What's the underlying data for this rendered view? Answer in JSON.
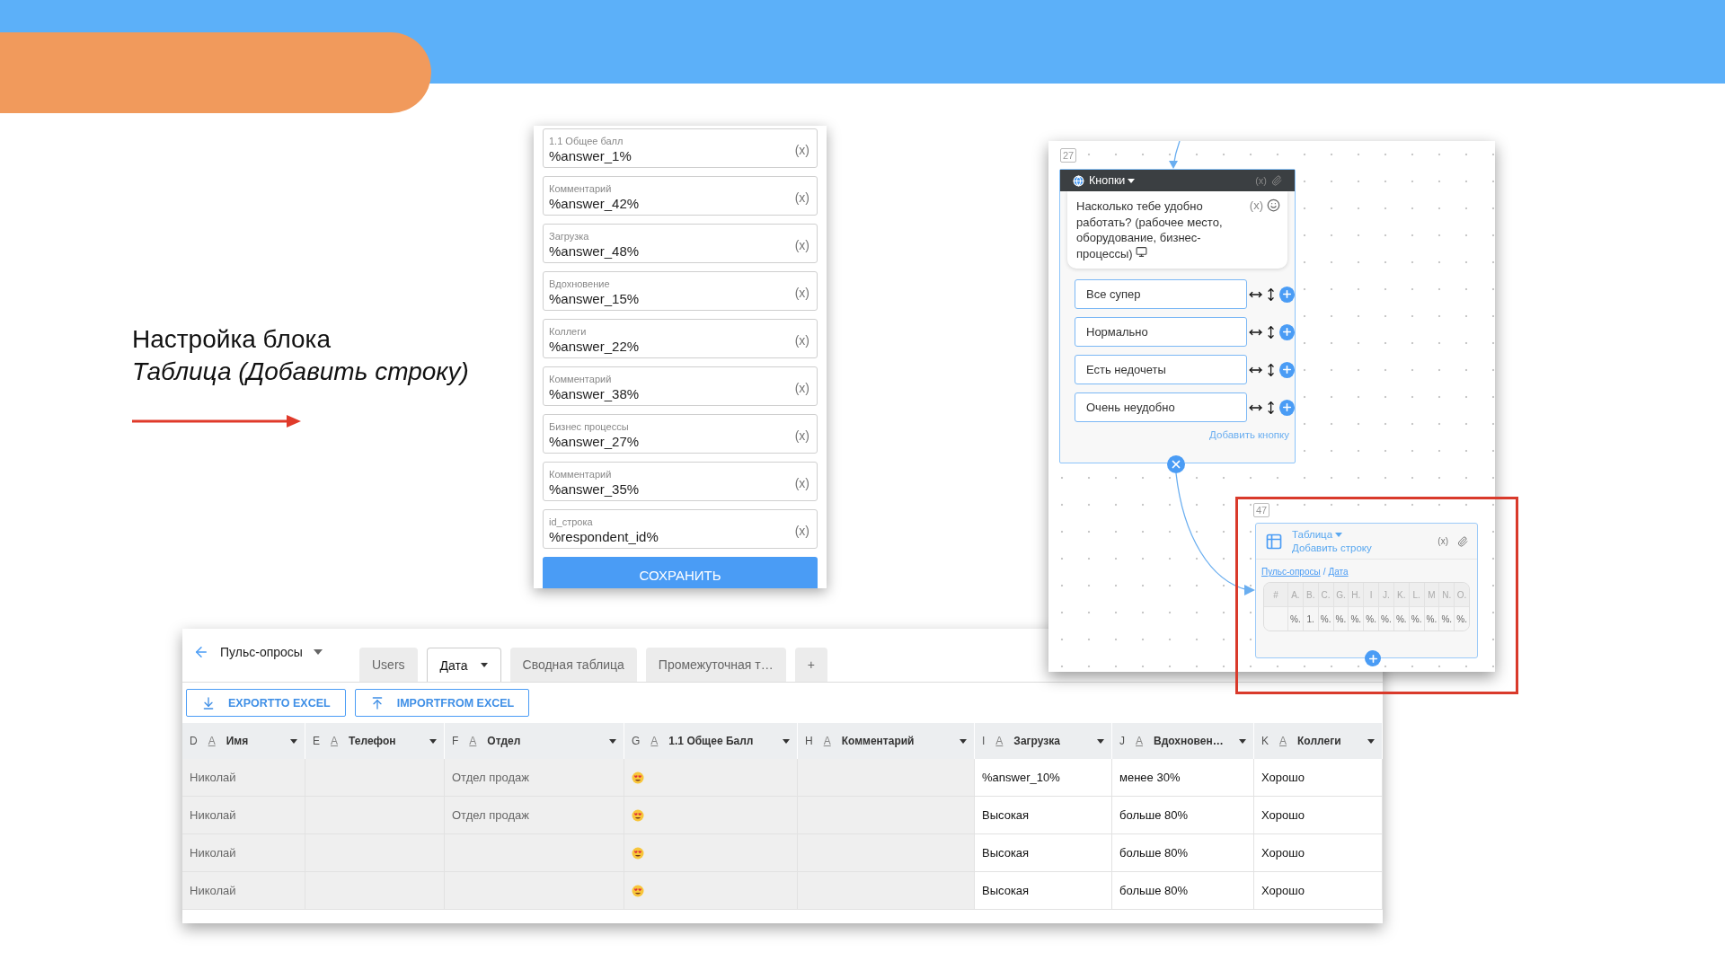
{
  "slide": {
    "heading": "Настройка блока",
    "subheading": "Таблица (Добавить строку)"
  },
  "form": {
    "fields": [
      {
        "label": "1.1 Общее балл",
        "value": "%answer_1%",
        "var": "(x)"
      },
      {
        "label": "Комментарий",
        "value": "%answer_42%",
        "var": "(x)"
      },
      {
        "label": "Загрузка",
        "value": "%answer_48%",
        "var": "(x)"
      },
      {
        "label": "Вдохновение",
        "value": "%answer_15%",
        "var": "(x)"
      },
      {
        "label": "Коллеги",
        "value": "%answer_22%",
        "var": "(x)"
      },
      {
        "label": "Комментарий",
        "value": "%answer_38%",
        "var": "(x)"
      },
      {
        "label": "Бизнес процессы",
        "value": "%answer_27%",
        "var": "(x)"
      },
      {
        "label": "Комментарий",
        "value": "%answer_35%",
        "var": "(x)"
      },
      {
        "label": "id_строка",
        "value": "%respondent_id%",
        "var": "(x)"
      }
    ],
    "save_button": "СОХРАНИТЬ"
  },
  "flow": {
    "buttons_node": {
      "number": "27",
      "title": "Кнопки",
      "var": "(x)",
      "message": "Насколько тебе удобно работать? (рабочее место, оборудование, бизнес-процессы)",
      "message_var": "(x)",
      "buttons": [
        "Все супер",
        "Нормально",
        "Есть недочеты",
        "Очень неудобно"
      ],
      "add_button": "Добавить кнопку"
    },
    "table_node": {
      "number": "47",
      "title": "Таблица",
      "subtitle": "Добавить строку",
      "var": "(x)",
      "link_1": "Пульс-опросы",
      "separator": "/",
      "link_2": "Дата",
      "columns": [
        "#",
        "A.",
        "B.",
        "C.",
        "G.",
        "H.",
        "I",
        "J.",
        "K.",
        "L.",
        "M",
        "N.",
        "O."
      ],
      "cells": [
        "%.",
        "1.",
        "%.",
        "%.",
        "%.",
        "%.",
        "%.",
        "%.",
        "%.",
        "%.",
        "%.",
        "%."
      ]
    }
  },
  "sheet": {
    "title": "Пульс-опросы",
    "tabs": [
      {
        "label": "Users",
        "selected": false
      },
      {
        "label": "Дата",
        "selected": true
      },
      {
        "label": "Сводная таблица",
        "selected": false
      },
      {
        "label": "Промежуточная т…",
        "selected": false
      }
    ],
    "add_tab": "+",
    "export_button": "EXPORTTO EXCEL",
    "import_button": "IMPORTFROM EXCEL",
    "columns": [
      {
        "letter": "D",
        "type": "A",
        "name": "Имя",
        "kind": "text",
        "locked": true
      },
      {
        "letter": "E",
        "type": "A",
        "name": "Телефон",
        "kind": "text",
        "locked": true
      },
      {
        "letter": "F",
        "type": "A",
        "name": "Отдел",
        "kind": "text",
        "locked": true
      },
      {
        "letter": "G",
        "type": "A",
        "name": "1.1 Общее Балл",
        "kind": "emoji",
        "locked": true
      },
      {
        "letter": "H",
        "type": "A",
        "name": "Комментарий",
        "kind": "text",
        "locked": true
      },
      {
        "letter": "I",
        "type": "A",
        "name": "Загрузка",
        "kind": "text",
        "locked": false
      },
      {
        "letter": "J",
        "type": "A",
        "name": "Вдохновен…",
        "kind": "text",
        "locked": false
      },
      {
        "letter": "K",
        "type": "A",
        "name": "Коллеги",
        "kind": "text",
        "locked": false
      }
    ],
    "rows": [
      {
        "cells": [
          "Николай",
          null,
          "Отдел продаж",
          null,
          null,
          "%answer_10%",
          "менее 30%",
          "Хорошо"
        ],
        "reaction": true
      },
      {
        "cells": [
          "Николай",
          null,
          "Отдел продаж",
          null,
          null,
          "Высокая",
          "больше 80%",
          "Хорошо"
        ],
        "reaction": true
      },
      {
        "cells": [
          "Николай",
          null,
          null,
          null,
          null,
          "Высокая",
          "больше 80%",
          "Хорошо"
        ],
        "reaction": true
      },
      {
        "cells": [
          "Николай",
          null,
          null,
          null,
          null,
          "Высокая",
          "больше 80%",
          "Хорошо"
        ],
        "reaction": true
      }
    ]
  }
}
